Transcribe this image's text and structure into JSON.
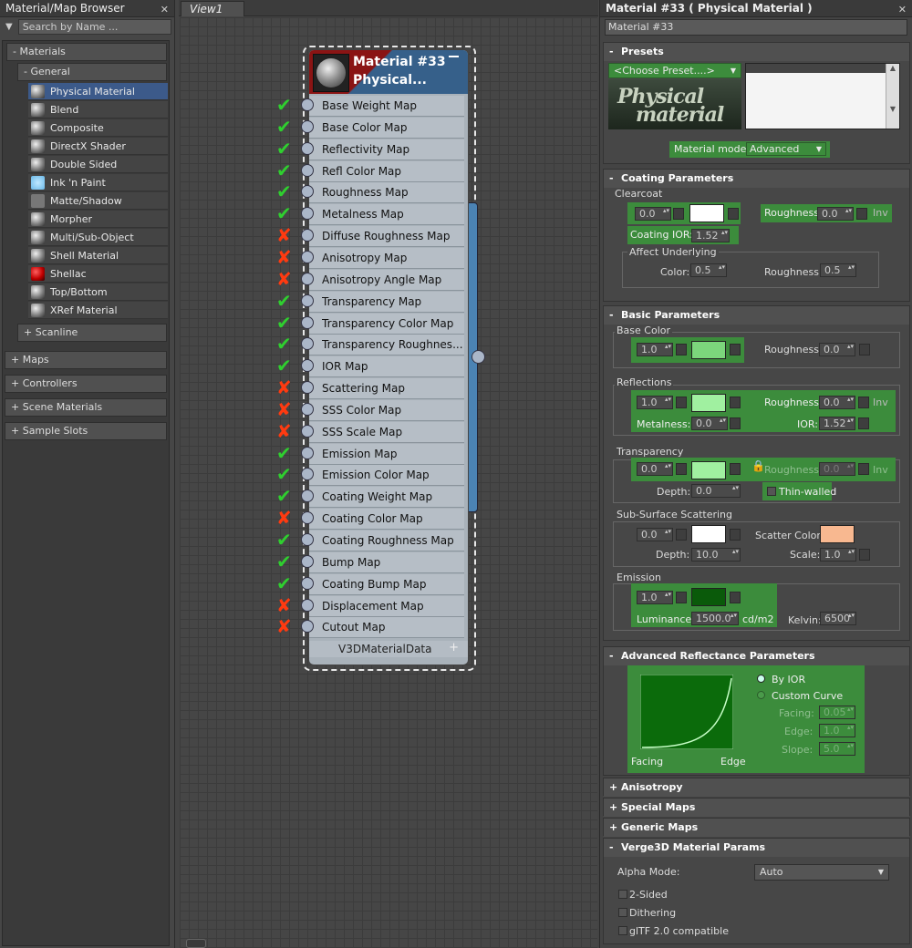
{
  "browser": {
    "title": "Material/Map Browser",
    "search_placeholder": "Search by Name ...",
    "group_materials": "- Materials",
    "group_general": "- General",
    "items": [
      {
        "label": "Physical Material",
        "icon": "sphere-icon"
      },
      {
        "label": "Blend",
        "icon": "sphere-icon"
      },
      {
        "label": "Composite",
        "icon": "sphere-icon"
      },
      {
        "label": "DirectX Shader",
        "icon": "sphere-icon"
      },
      {
        "label": "Double Sided",
        "icon": "sphere-icon"
      },
      {
        "label": "Ink 'n Paint",
        "icon": "ink-paint-icon"
      },
      {
        "label": "Matte/Shadow",
        "icon": "matte-icon"
      },
      {
        "label": "Morpher",
        "icon": "sphere-icon"
      },
      {
        "label": "Multi/Sub-Object",
        "icon": "sphere-icon"
      },
      {
        "label": "Shell Material",
        "icon": "sphere-icon"
      },
      {
        "label": "Shellac",
        "icon": "shellac-icon"
      },
      {
        "label": "Top/Bottom",
        "icon": "sphere-icon"
      },
      {
        "label": "XRef Material",
        "icon": "sphere-icon"
      }
    ],
    "group_scanline": "+ Scanline",
    "group_maps": "+ Maps",
    "group_controllers": "+ Controllers",
    "group_scene": "+ Scene Materials",
    "group_sample": "+ Sample Slots"
  },
  "view": {
    "tab": "View1"
  },
  "node": {
    "title1": "Material #33",
    "title2": "Physical...",
    "slots": [
      {
        "label": "Base Weight Map",
        "ok": true
      },
      {
        "label": "Base Color Map",
        "ok": true
      },
      {
        "label": "Reflectivity Map",
        "ok": true
      },
      {
        "label": "Refl Color Map",
        "ok": true
      },
      {
        "label": "Roughness Map",
        "ok": true
      },
      {
        "label": "Metalness Map",
        "ok": true
      },
      {
        "label": "Diffuse Roughness Map",
        "ok": false
      },
      {
        "label": "Anisotropy Map",
        "ok": false
      },
      {
        "label": "Anisotropy Angle Map",
        "ok": false
      },
      {
        "label": "Transparency Map",
        "ok": true
      },
      {
        "label": "Transparency Color Map",
        "ok": true
      },
      {
        "label": "Transparency Roughnes...",
        "ok": true
      },
      {
        "label": "IOR Map",
        "ok": true
      },
      {
        "label": "Scattering Map",
        "ok": false
      },
      {
        "label": "SSS Color Map",
        "ok": false
      },
      {
        "label": "SSS Scale Map",
        "ok": false
      },
      {
        "label": "Emission Map",
        "ok": true
      },
      {
        "label": "Emission Color Map",
        "ok": true
      },
      {
        "label": "Coating Weight Map",
        "ok": true
      },
      {
        "label": "Coating Color Map",
        "ok": false
      },
      {
        "label": "Coating Roughness Map",
        "ok": true
      },
      {
        "label": "Bump Map",
        "ok": true
      },
      {
        "label": "Coating Bump Map",
        "ok": true
      },
      {
        "label": "Displacement Map",
        "ok": false
      },
      {
        "label": "Cutout Map",
        "ok": false
      }
    ],
    "footer": "V3DMaterialData",
    "check_glyph": "✔",
    "cross_glyph": "✘"
  },
  "mat": {
    "title": "Material #33  ( Physical Material )",
    "name": "Material #33",
    "presets": {
      "header": "Presets",
      "choose": "<Choose Preset....>",
      "logo1": "Physical",
      "logo2": "material",
      "mode_label": "Material mode:",
      "mode_value": "Advanced"
    },
    "coating": {
      "header": "Coating Parameters",
      "clearcoat": "Clearcoat",
      "weight": "0.0",
      "roughness_label": "Roughness:",
      "roughness": "0.0",
      "inv": "Inv",
      "ior_label": "Coating IOR:",
      "ior": "1.52",
      "affect": "Affect Underlying",
      "color_label": "Color:",
      "color_val": "0.5",
      "rough2_label": "Roughness:",
      "rough2_val": "0.5"
    },
    "basic": {
      "header": "Basic Parameters",
      "base_color": "Base Color",
      "base_weight": "1.0",
      "base_rough_label": "Roughness:",
      "base_rough": "0.0",
      "reflections": "Reflections",
      "refl_weight": "1.0",
      "refl_rough_label": "Roughness:",
      "refl_rough": "0.0",
      "refl_inv": "Inv",
      "metal_label": "Metalness:",
      "metal": "0.0",
      "ior_label": "IOR:",
      "ior": "1.52",
      "transparency": "Transparency",
      "trans_weight": "0.0",
      "trans_rough_label": "Roughness:",
      "trans_rough": "0.0",
      "trans_inv": "Inv",
      "depth_label": "Depth:",
      "depth": "0.0",
      "thin": "Thin-walled",
      "sss": "Sub-Surface Scattering",
      "sss_weight": "0.0",
      "scatter_label": "Scatter Color:",
      "sss_depth_label": "Depth:",
      "sss_depth": "10.0",
      "scale_label": "Scale:",
      "scale": "1.0",
      "emission": "Emission",
      "em_weight": "1.0",
      "lum_label": "Luminance:",
      "lum": "1500.0",
      "lum_unit": "cd/m2",
      "kelvin_label": "Kelvin:",
      "kelvin": "6500"
    },
    "adv": {
      "header": "Advanced Reflectance Parameters",
      "by_ior": "By IOR",
      "custom": "Custom Curve",
      "facing_label": "Facing:",
      "facing": "0.05",
      "edge_label": "Edge:",
      "edge": "1.0",
      "slope_label": "Slope:",
      "slope": "5.0",
      "graph_facing": "Facing",
      "graph_edge": "Edge"
    },
    "aniso": "Anisotropy",
    "special": "Special Maps",
    "generic": "Generic Maps",
    "v3d": {
      "header": "Verge3D Material Params",
      "alpha_label": "Alpha Mode:",
      "alpha_value": "Auto",
      "two_sided": "2-Sided",
      "dithering": "Dithering",
      "gltf": "glTF 2.0 compatible"
    },
    "colors": {
      "base": "#7cd67c",
      "refl": "#a0f0a0",
      "trans": "#a0f0a0",
      "sss_color": "#ffffff",
      "scatter": "#f8b890",
      "emission": "#0a5a0a",
      "coat_color": "#ffffff"
    }
  }
}
